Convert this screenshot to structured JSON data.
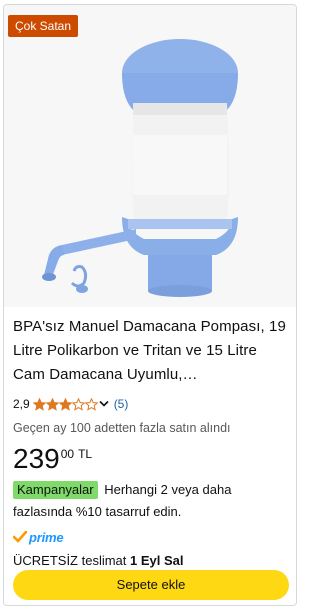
{
  "badge": {
    "label": "Çok Satan",
    "color": "#cc4b00"
  },
  "product": {
    "image_icon": "water-dispenser-pump-image",
    "title": "BPA'sız Manuel Damacana Pompası, 19 Litre Polikarbon ve Tritan ve 15 Litre Cam Damacana Uyumlu,…",
    "rating_value": "2,9",
    "rating_stars": 3,
    "rating_max": 5,
    "rating_count": "(5)",
    "bought_text": "Geçen ay 100 adetten fazla satın alındı",
    "price_whole": "239",
    "price_fraction": "00",
    "price_currency": "TL"
  },
  "promo": {
    "tag": "Kampanyalar",
    "text": "Herhangi 2 veya daha fazlasında %10 tasarruf edin.",
    "tag_color": "#7fda69"
  },
  "prime": {
    "label": "prime",
    "check_icon": "prime-check-icon",
    "color": "#1a98ff"
  },
  "delivery": {
    "prefix": "ÜCRETSİZ teslimat",
    "date": "1 Eyl Sal"
  },
  "cart_button": {
    "label": "Sepete ekle",
    "color": "#ffd814"
  }
}
